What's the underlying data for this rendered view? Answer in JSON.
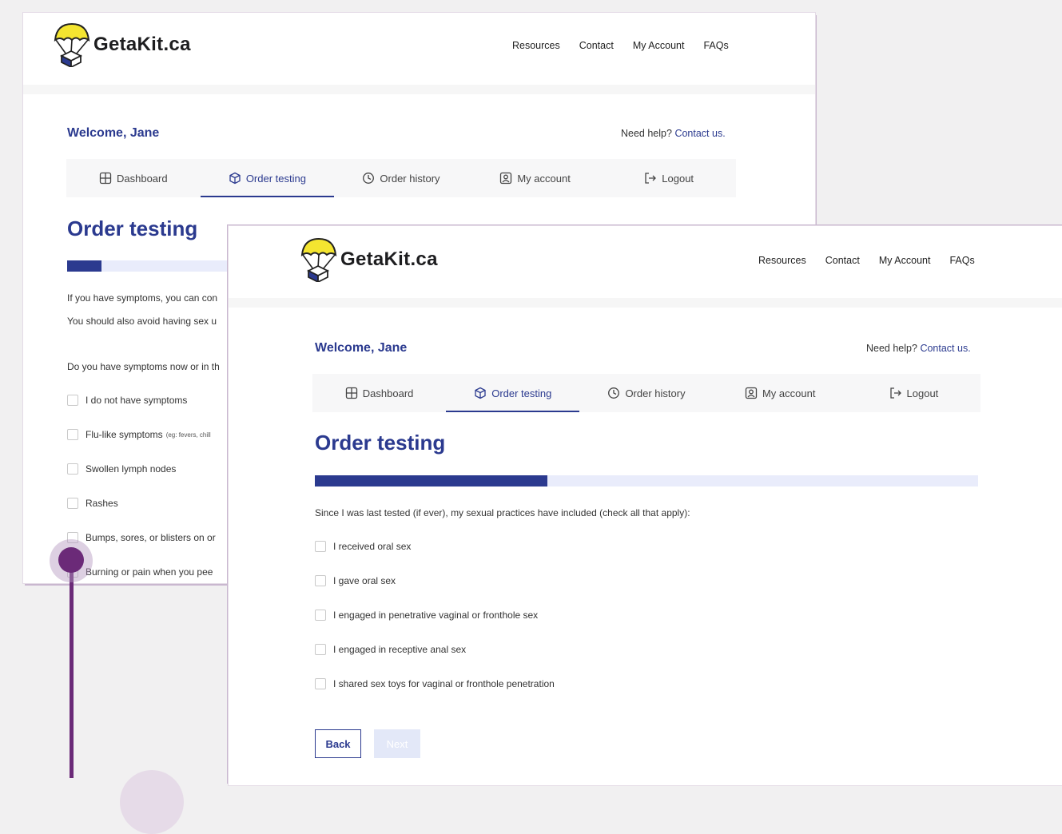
{
  "brand": {
    "name": "GetaKit.ca",
    "logo_icon": "parachute-box-icon"
  },
  "nav": [
    "Resources",
    "Contact",
    "My Account",
    "FAQs"
  ],
  "welcome": "Welcome, Jane",
  "help": {
    "prefix": "Need help?",
    "link": "Contact us."
  },
  "tabs": [
    {
      "label": "Dashboard",
      "icon": "grid-icon"
    },
    {
      "label": "Order testing",
      "icon": "box-icon"
    },
    {
      "label": "Order history",
      "icon": "clock-icon"
    },
    {
      "label": "My account",
      "icon": "user-icon"
    },
    {
      "label": "Logout",
      "icon": "logout-icon"
    }
  ],
  "page_title": "Order testing",
  "back_window": {
    "progress": 0.05,
    "intro_line1": "If you have symptoms, you can con",
    "intro_line2": "You should also avoid having sex u",
    "question": "Do you have symptoms now or in th",
    "options": [
      {
        "label": "I do not have symptoms",
        "note": ""
      },
      {
        "label": "Flu-like symptoms",
        "note": "(eg: fevers, chill"
      },
      {
        "label": "Swollen lymph nodes",
        "note": ""
      },
      {
        "label": "Rashes",
        "note": ""
      },
      {
        "label": "Bumps, sores, or blisters on or",
        "note": ""
      },
      {
        "label": "Burning or pain when you pee",
        "note": ""
      }
    ]
  },
  "front_window": {
    "progress": 0.35,
    "question": "Since I was last tested (if ever), my sexual practices have included (check all that apply):",
    "options": [
      "I received oral sex",
      "I gave oral sex",
      "I engaged in penetrative vaginal or fronthole sex",
      "I engaged in receptive anal sex",
      "I shared sex toys for vaginal or fronthole penetration"
    ],
    "back_label": "Back",
    "next_label": "Next"
  },
  "colors": {
    "primary": "#2b3a8f",
    "accent": "#6b2a78",
    "progress_bg": "#e9ecfb"
  }
}
